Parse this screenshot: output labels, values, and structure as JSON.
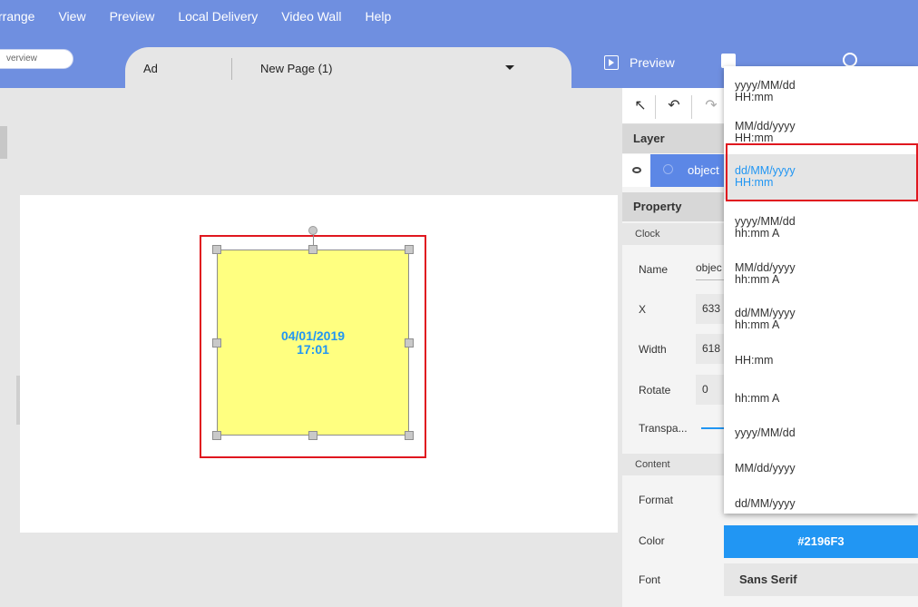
{
  "menu": [
    "rrange",
    "View",
    "Preview",
    "Local Delivery",
    "Video Wall",
    "Help"
  ],
  "overview_label": "verview",
  "tabs": {
    "ad": "Ad",
    "page": "New Page (1)"
  },
  "actions": {
    "preview": "Preview"
  },
  "layer_panel": {
    "title": "Layer",
    "item": "object"
  },
  "property_panel": {
    "title": "Property",
    "clock_section": "Clock",
    "name_label": "Name",
    "name_value": "objec",
    "x_label": "X",
    "x_value": "633",
    "width_label": "Width",
    "width_value": "618",
    "rotate_label": "Rotate",
    "rotate_value": "0",
    "transparency_label": "Transpa...",
    "content_section": "Content",
    "format_label": "Format",
    "color_label": "Color",
    "color_value": "#2196F3",
    "font_label": "Font",
    "font_value": "Sans Serif"
  },
  "clock": {
    "date": "04/01/2019",
    "time": "17:01",
    "text_color": "#2196f3",
    "background": "#ffff80"
  },
  "format_dropdown": {
    "selected_index": 2,
    "options": [
      "yyyy/MM/dd\nHH:mm",
      "MM/dd/yyyy\nHH:mm",
      "dd/MM/yyyy\nHH:mm",
      "yyyy/MM/dd\nhh:mm A",
      "MM/dd/yyyy\nhh:mm A",
      "dd/MM/yyyy\nhh:mm A",
      "HH:mm",
      "hh:mm A",
      "yyyy/MM/dd",
      "MM/dd/yyyy",
      "dd/MM/yyyy"
    ]
  },
  "colors": {
    "accent": "#2196f3",
    "topbar": "#6f8fe0",
    "highlight": "#e0171f",
    "layer_selected": "#5c87e6"
  }
}
